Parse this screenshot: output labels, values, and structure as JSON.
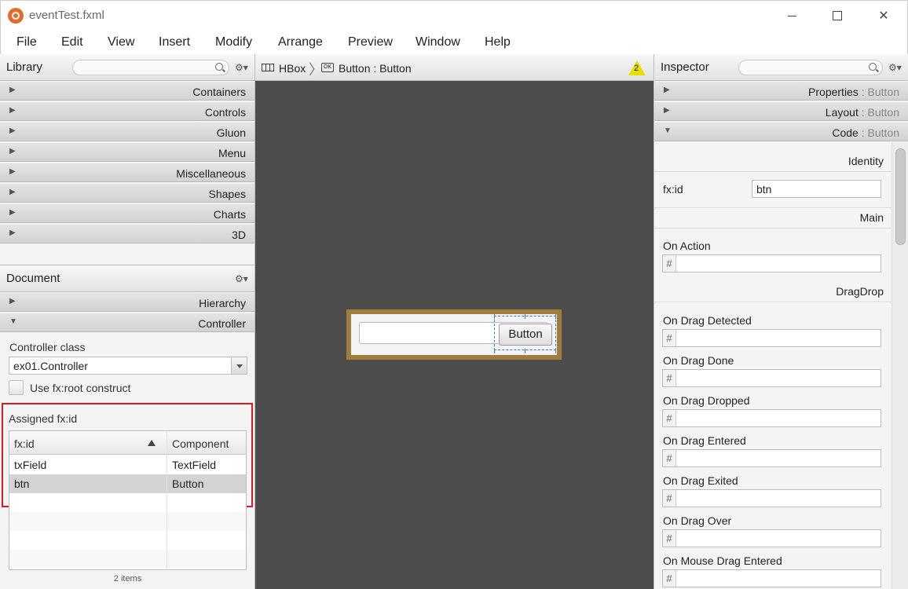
{
  "window": {
    "title": "eventTest.fxml"
  },
  "menu": [
    "File",
    "Edit",
    "View",
    "Insert",
    "Modify",
    "Arrange",
    "Preview",
    "Window",
    "Help"
  ],
  "library": {
    "title": "Library",
    "sections": [
      "Containers",
      "Controls",
      "Gluon",
      "Menu",
      "Miscellaneous",
      "Shapes",
      "Charts",
      "3D"
    ]
  },
  "document": {
    "title": "Document",
    "sections": [
      "Hierarchy",
      "Controller"
    ],
    "controller_class_label": "Controller class",
    "controller_class_value": "ex01.Controller",
    "use_root_label": "Use fx:root construct",
    "assigned_label": "Assigned fx:id",
    "table": {
      "headers": [
        "fx:id",
        "Component"
      ],
      "rows": [
        {
          "id": "txField",
          "component": "TextField"
        },
        {
          "id": "btn",
          "component": "Button"
        }
      ]
    },
    "items_count": "2 items"
  },
  "breadcrumb": {
    "items": [
      "HBox",
      "Button : Button"
    ],
    "ok_icon_text": "OK",
    "warning_count": "2"
  },
  "canvas": {
    "button_label": "Button"
  },
  "inspector": {
    "title": "Inspector",
    "sections": [
      {
        "name": "Properties",
        "suffix": " : Button"
      },
      {
        "name": "Layout",
        "suffix": " : Button"
      },
      {
        "name": "Code",
        "suffix": " : Button"
      }
    ],
    "identity": "Identity",
    "fxid_label": "fx:id",
    "fxid_value": "btn",
    "main": "Main",
    "on_action": "On Action",
    "dragdrop": "DragDrop",
    "events": [
      "On Drag Detected",
      "On Drag Done",
      "On Drag Dropped",
      "On Drag Entered",
      "On Drag Exited",
      "On Drag Over",
      "On Mouse Drag Entered"
    ],
    "hash_symbol": "#"
  },
  "colors": {
    "selection_frame": "#a07d3d",
    "highlight": "#e0191e",
    "warning": "#e8e000"
  }
}
